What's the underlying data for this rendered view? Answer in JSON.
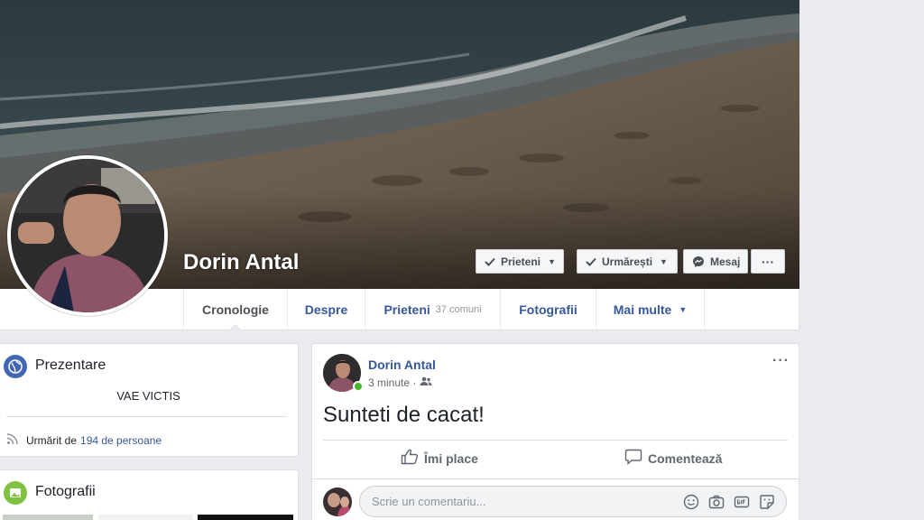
{
  "profile": {
    "name": "Dorin Antal"
  },
  "cover_buttons": {
    "friends": "Prieteni",
    "follow": "Urmărești",
    "message": "Mesaj",
    "more": "···"
  },
  "nav": {
    "tabs": [
      {
        "label": "Cronologie",
        "sub": ""
      },
      {
        "label": "Despre",
        "sub": ""
      },
      {
        "label": "Prieteni",
        "sub": "37 comuni"
      },
      {
        "label": "Fotografii",
        "sub": ""
      },
      {
        "label": "Mai multe",
        "sub": ""
      }
    ]
  },
  "intro": {
    "title": "Prezentare",
    "bio": "VAE VICTIS",
    "followed_prefix": "Urmărit de",
    "followed_link": "194 de persoane"
  },
  "photos": {
    "title": "Fotografii"
  },
  "post": {
    "author": "Dorin Antal",
    "time": "3 minute ·",
    "text": "Sunteti de cacat!",
    "menu": "···",
    "like_label": "Îmi place",
    "comment_label": "Comentează"
  },
  "comment": {
    "placeholder": "Scrie un comentariu..."
  },
  "colors": {
    "link": "#365899",
    "online": "#42b72a",
    "background": "#e9ebee"
  }
}
